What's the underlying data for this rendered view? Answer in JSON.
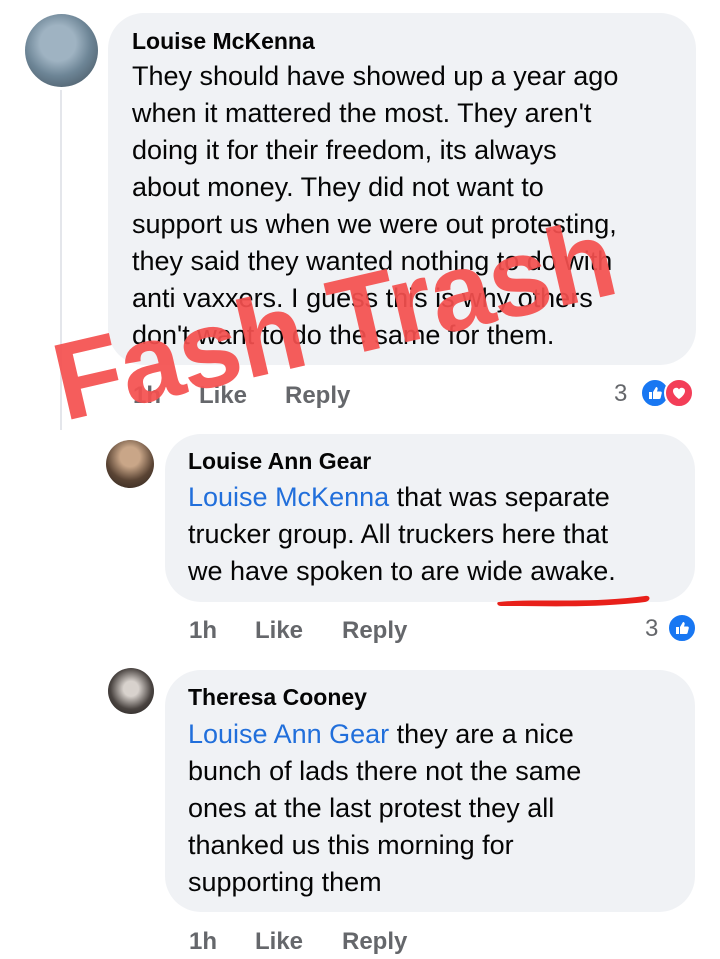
{
  "comments": [
    {
      "author": "Louise McKenna",
      "body_lines": [
        "They should have showed up a year ago",
        "when it mattered the most. They aren't",
        "doing it for their freedom, its always",
        "about money. They did not want to",
        "support us when we were out protesting,",
        "they said they wanted nothing  to do with",
        "anti vaxxers. I guess this is why others",
        "don't want to do the same for them."
      ],
      "time": "1h",
      "like_label": "Like",
      "reply_label": "Reply",
      "reaction_count": "3",
      "reactions": [
        "like-icon",
        "love-icon"
      ]
    },
    {
      "author": "Louise Ann Gear",
      "mention": "Louise McKenna",
      "body_lines": [
        " that was separate",
        "trucker group. All truckers here that",
        "we have spoken to are wide awake."
      ],
      "time": "1h",
      "like_label": "Like",
      "reply_label": "Reply",
      "reaction_count": "3",
      "reactions": [
        "like-icon"
      ]
    },
    {
      "author": "Theresa Cooney",
      "mention": "Louise Ann Gear",
      "body_lines": [
        " they are a nice",
        "bunch of lads there not the same",
        "ones at the last protest they all",
        "thanked us this morning for",
        "supporting them"
      ],
      "time": "1h",
      "like_label": "Like",
      "reply_label": "Reply"
    }
  ],
  "overlay": {
    "watermark_text": "Fash Trash",
    "watermark_color": "#f5504f",
    "underline_color": "#e8201a"
  },
  "colors": {
    "bubble": "#f0f2f5",
    "mention": "#216fdb",
    "meta": "#65676b",
    "like": "#1877f2",
    "love": "#f33e58"
  }
}
